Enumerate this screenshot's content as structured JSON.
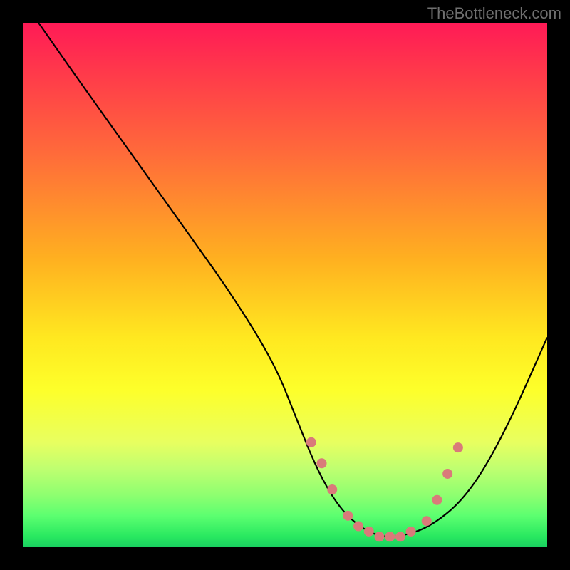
{
  "watermark": "TheBottleneck.com",
  "chart_data": {
    "type": "line",
    "title": "",
    "xlabel": "",
    "ylabel": "",
    "xlim": [
      0,
      100
    ],
    "ylim": [
      0,
      100
    ],
    "series": [
      {
        "name": "curve",
        "x": [
          3,
          10,
          20,
          30,
          40,
          48,
          52,
          56,
          60,
          64,
          68,
          72,
          78,
          85,
          92,
          100
        ],
        "y": [
          100,
          90,
          76,
          62,
          48,
          35,
          25,
          15,
          8,
          4,
          2,
          2,
          4,
          10,
          22,
          40
        ]
      }
    ],
    "markers": {
      "name": "dots",
      "color": "#d97a7a",
      "x": [
        55,
        57,
        59,
        62,
        64,
        66,
        68,
        70,
        72,
        74,
        77,
        79,
        81,
        83
      ],
      "y": [
        20,
        16,
        11,
        6,
        4,
        3,
        2,
        2,
        2,
        3,
        5,
        9,
        14,
        19
      ]
    },
    "gradient_stops": [
      {
        "pos": 0.0,
        "color": "#ff1a56"
      },
      {
        "pos": 0.7,
        "color": "#fdff2a"
      },
      {
        "pos": 1.0,
        "color": "#1ad060"
      }
    ]
  }
}
